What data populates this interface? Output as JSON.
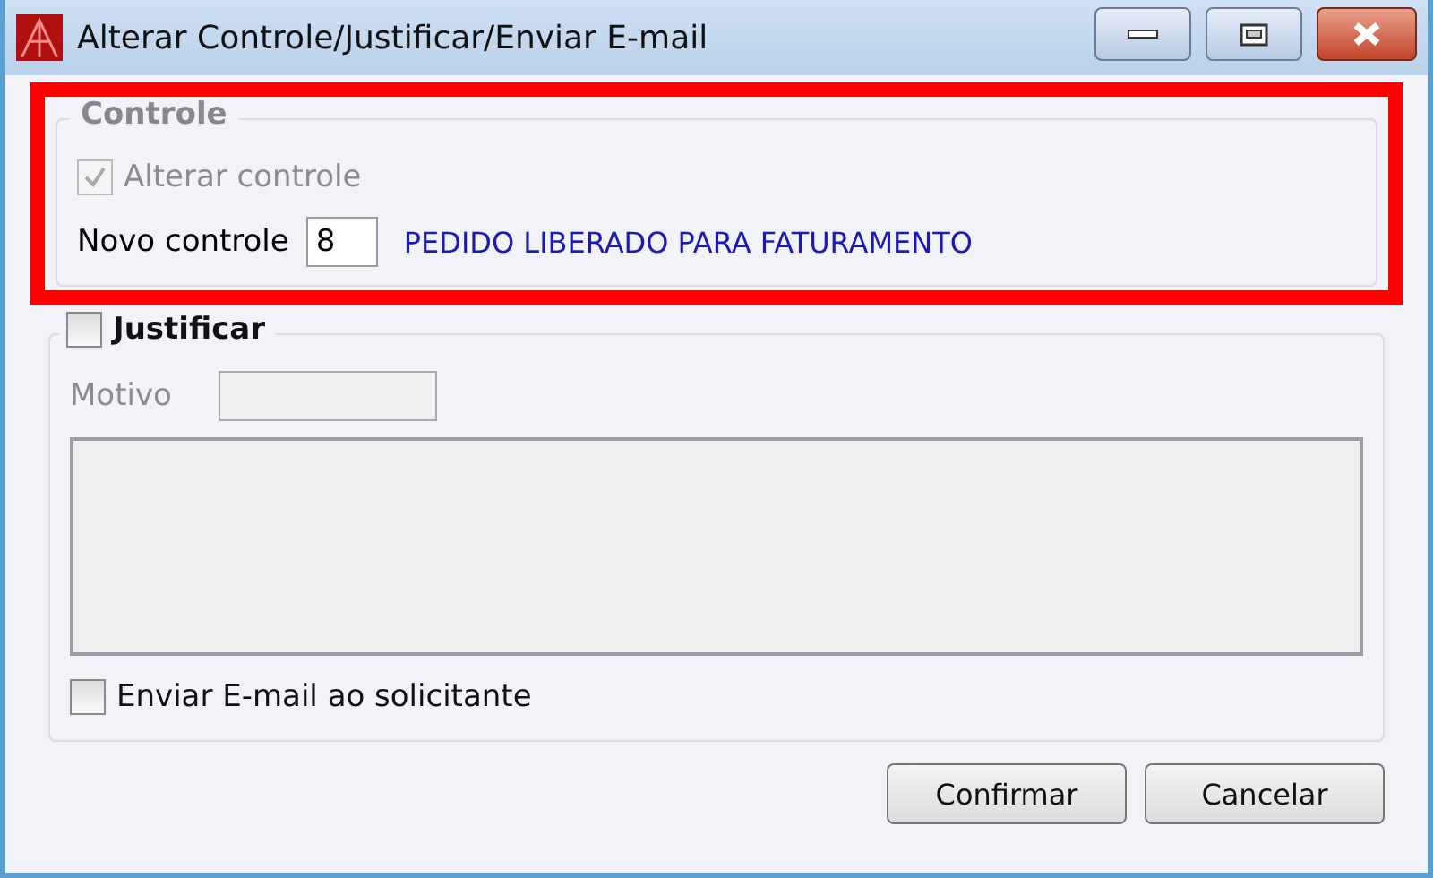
{
  "window": {
    "title": "Alterar Controle/Justificar/Enviar E-mail"
  },
  "controle": {
    "title": "Controle",
    "highlighted": true,
    "alterar": {
      "label": "Alterar controle",
      "checked": true,
      "disabled": true
    },
    "novo": {
      "label": "Novo controle",
      "value": "8",
      "status": "PEDIDO LIBERADO PARA FATURAMENTO"
    }
  },
  "justificar": {
    "label": "Justificar",
    "checked": false,
    "motivo": {
      "label": "Motivo",
      "disabled": true
    },
    "memo": {
      "disabled": true
    },
    "email": {
      "label": "Enviar E-mail ao solicitante",
      "checked": false
    }
  },
  "buttons": [
    {
      "label": "Confirmar"
    },
    {
      "label": "Cancelar"
    }
  ]
}
